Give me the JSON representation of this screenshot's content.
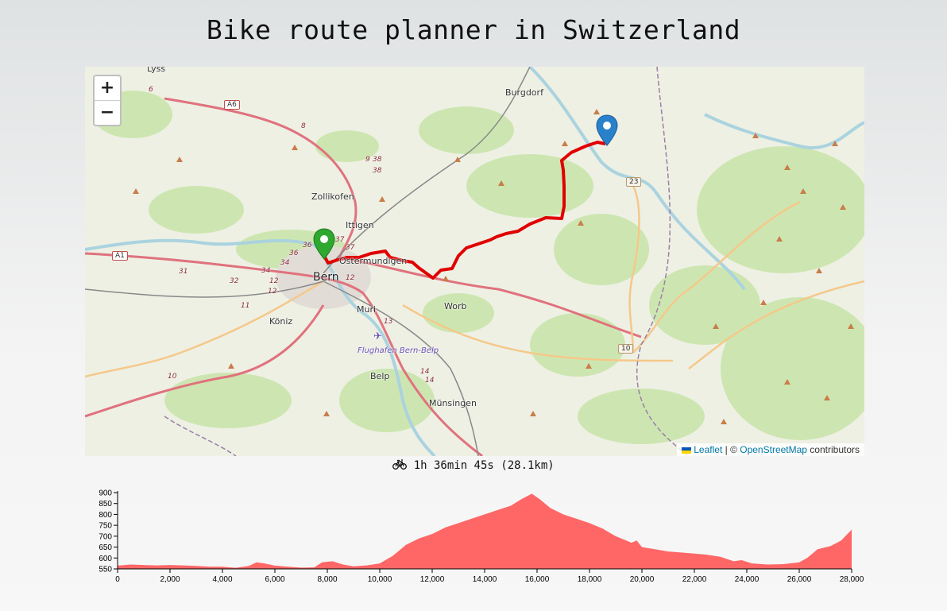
{
  "page": {
    "title": "Bike route planner in Switzerland"
  },
  "map": {
    "zoom_in": "+",
    "zoom_out": "−",
    "attribution": {
      "leaflet": "Leaflet",
      "separator": " | © ",
      "osm": "OpenStreetMap",
      "suffix": " contributors"
    },
    "places": {
      "lyss": "Lyss",
      "burgdorf": "Burgdorf",
      "zollikofen": "Zollikofen",
      "ittigen": "Ittigen",
      "ostermundigen": "Ostermundigen",
      "bern": "Bern",
      "muri": "Muri",
      "koniz": "Köniz",
      "worb": "Worb",
      "airport": "Flughafen Bern-Belp",
      "belp": "Belp",
      "munsingen": "Münsingen"
    },
    "road_labels": {
      "a6": "A6",
      "a1": "A1",
      "r23": "23",
      "r10": "10",
      "n6": "6",
      "n8": "8",
      "n9": "9",
      "n38a": "38",
      "n38b": "38",
      "n31": "31",
      "n32": "32",
      "n34a": "34",
      "n34b": "34",
      "n36a": "36",
      "n36b": "36",
      "n37a": "37",
      "n37b": "37",
      "n12a": "12",
      "n12b": "12",
      "n12c": "12",
      "n11": "11",
      "n13": "13",
      "n14a": "14",
      "n14b": "14",
      "n10": "10"
    },
    "start_marker_color": "#2fa82f",
    "end_marker_color": "#2a81cb",
    "route_color": "#e00000"
  },
  "summary": {
    "icon": "bicycle-icon",
    "text": "1h 36min 45s (28.1km)"
  },
  "chart_data": {
    "type": "area",
    "color": "#ff6666",
    "xlim": [
      0,
      28000
    ],
    "ylim": [
      550,
      900
    ],
    "x_ticks": [
      "0",
      "2,000",
      "4,000",
      "6,000",
      "8,000",
      "10,000",
      "12,000",
      "14,000",
      "16,000",
      "18,000",
      "20,000",
      "22,000",
      "24,000",
      "26,000",
      "28,000"
    ],
    "y_ticks": [
      "550",
      "600",
      "650",
      "700",
      "750",
      "800",
      "850",
      "900"
    ],
    "x": [
      0,
      500,
      1000,
      1500,
      2000,
      2500,
      3000,
      3500,
      4000,
      4500,
      5000,
      5300,
      5600,
      6000,
      6500,
      7000,
      7500,
      7800,
      8200,
      8600,
      9000,
      9500,
      10000,
      10500,
      11000,
      11500,
      12000,
      12500,
      13000,
      13500,
      14000,
      14500,
      15000,
      15400,
      15800,
      16100,
      16500,
      17000,
      17500,
      18000,
      18500,
      19000,
      19400,
      19600,
      19800,
      20000,
      20500,
      21000,
      21500,
      22000,
      22500,
      23000,
      23500,
      23800,
      24200,
      24800,
      25400,
      26000,
      26300,
      26700,
      27200,
      27600,
      28000
    ],
    "y": [
      565,
      570,
      568,
      566,
      568,
      566,
      564,
      560,
      560,
      555,
      563,
      580,
      575,
      565,
      560,
      556,
      557,
      580,
      585,
      570,
      562,
      566,
      575,
      610,
      660,
      690,
      710,
      740,
      760,
      780,
      800,
      820,
      840,
      870,
      895,
      870,
      830,
      800,
      780,
      760,
      735,
      700,
      680,
      670,
      680,
      650,
      640,
      630,
      625,
      620,
      615,
      605,
      585,
      590,
      575,
      570,
      572,
      580,
      600,
      640,
      655,
      680,
      730
    ]
  }
}
